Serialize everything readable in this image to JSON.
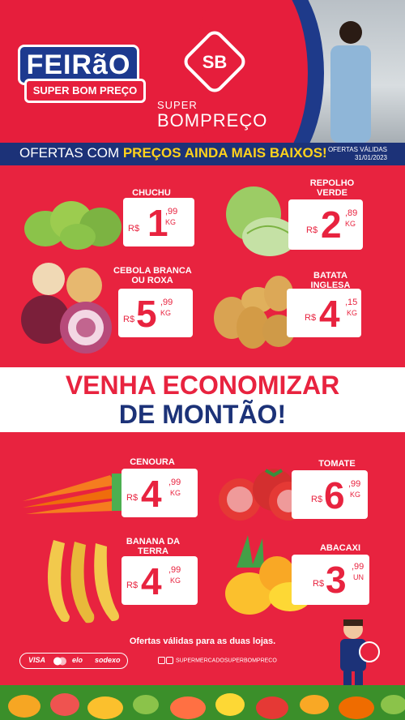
{
  "header": {
    "feirao_title": "FEIRãO",
    "feirao_subtitle": "SUPER BOM PREÇO",
    "logo_super": "SUPER",
    "logo_bompreco": "BOMPREÇO"
  },
  "banner": {
    "text_start": "OFERTAS COM ",
    "text_highlight": "PREÇOS AINDA MAIS BAIXOS!",
    "valid_label": "OFERTAS VÁLIDAS",
    "valid_date": "31/01/2023"
  },
  "products": [
    {
      "name_line1": "CHUCHU",
      "name_line2": "",
      "currency": "R$",
      "integer": "1",
      "cents": ",99",
      "unit": "KG"
    },
    {
      "name_line1": "REPOLHO",
      "name_line2": "VERDE",
      "currency": "R$",
      "integer": "2",
      "cents": ",89",
      "unit": "KG"
    },
    {
      "name_line1": "CEBOLA BRANCA",
      "name_line2": "OU ROXA",
      "currency": "R$",
      "integer": "5",
      "cents": ",99",
      "unit": "KG"
    },
    {
      "name_line1": "BATATA",
      "name_line2": "INGLESA",
      "currency": "R$",
      "integer": "4",
      "cents": ",15",
      "unit": "KG"
    },
    {
      "name_line1": "CENOURA",
      "name_line2": "",
      "currency": "R$",
      "integer": "4",
      "cents": ",99",
      "unit": "KG"
    },
    {
      "name_line1": "TOMATE",
      "name_line2": "",
      "currency": "R$",
      "integer": "6",
      "cents": ",99",
      "unit": "KG"
    },
    {
      "name_line1": "BANANA DA",
      "name_line2": "TERRA",
      "currency": "R$",
      "integer": "4",
      "cents": ",99",
      "unit": "KG"
    },
    {
      "name_line1": "ABACAXI",
      "name_line2": "",
      "currency": "R$",
      "integer": "3",
      "cents": ",99",
      "unit": "UN"
    }
  ],
  "slogan": {
    "line1": "VENHA ECONOMIZAR",
    "line2": "DE MONTÃO!"
  },
  "footer": {
    "offers_note": "Ofertas válidas para as duas lojas.",
    "pay_visa": "VISA",
    "pay_elo": "elo",
    "pay_sodexo": "sodexo",
    "social_handle": "SUPERMERCADOSUPERBOMPRECO"
  },
  "colors": {
    "red": "#e8233f",
    "navy": "#1c3278",
    "yellow": "#ffd21c",
    "white": "#ffffff"
  }
}
